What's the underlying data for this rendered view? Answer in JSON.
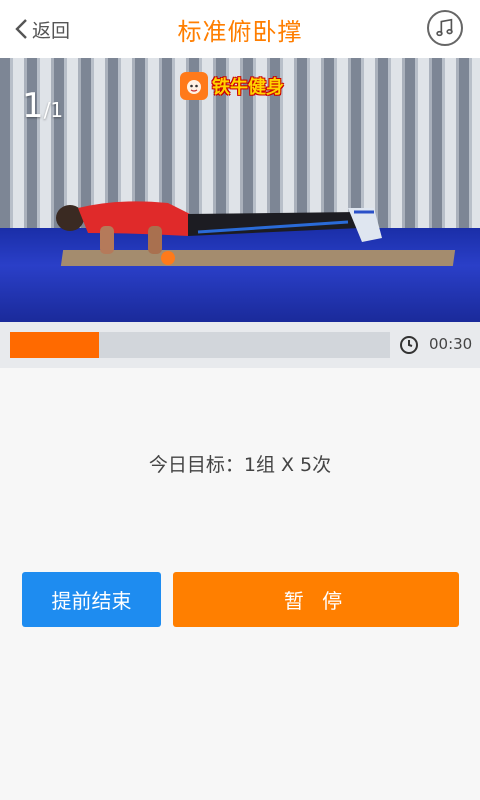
{
  "header": {
    "back_label": "返回",
    "title": "标准俯卧撑",
    "back_icon": "chevron-left-icon",
    "music_icon": "music-note-icon"
  },
  "video": {
    "current": "1",
    "total": "/1",
    "logo_text": "铁牛健身"
  },
  "progress": {
    "fraction": 0.235,
    "time": "00:30",
    "clock_icon": "clock-icon"
  },
  "goal_text": "今日目标：1组 X 5次",
  "buttons": {
    "end_label": "提前结束",
    "pause_label": "暂 停"
  },
  "colors": {
    "accent_orange": "#ff7e00",
    "end_blue": "#1e8cf0",
    "progress_fill": "#ff6a00"
  }
}
